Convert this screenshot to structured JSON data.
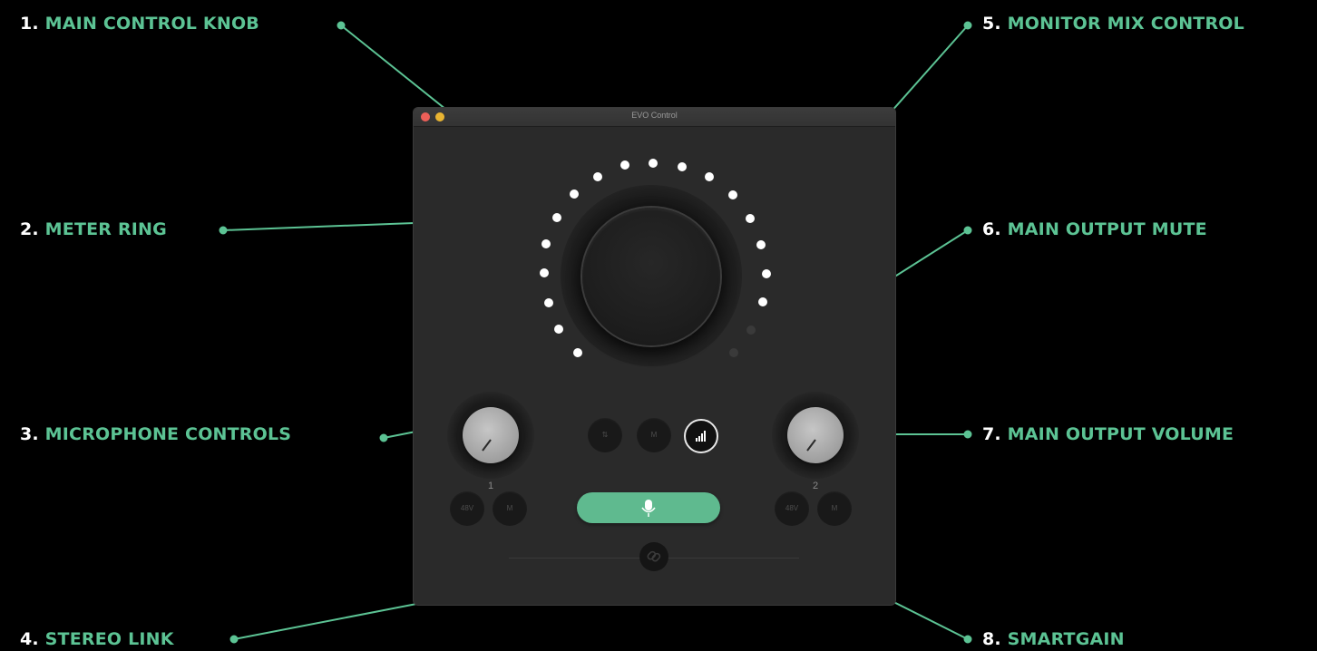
{
  "callouts": [
    {
      "num": "1.",
      "text": "MAIN CONTROL KNOB"
    },
    {
      "num": "2.",
      "text": "METER RING"
    },
    {
      "num": "3.",
      "text": "MICROPHONE CONTROLS"
    },
    {
      "num": "4.",
      "text": "STEREO LINK"
    },
    {
      "num": "5.",
      "text": "MONITOR MIX CONTROL"
    },
    {
      "num": "6.",
      "text": "MAIN OUTPUT MUTE"
    },
    {
      "num": "7.",
      "text": "MAIN OUTPUT VOLUME"
    },
    {
      "num": "8.",
      "text": "SMARTGAIN"
    }
  ],
  "window": {
    "title": "EVO Control"
  },
  "channels": [
    {
      "number": "1",
      "phantom_label": "48V",
      "mute_label": "M"
    },
    {
      "number": "2",
      "phantom_label": "48V",
      "mute_label": "M"
    }
  ],
  "output_buttons": {
    "monitor_label": "⇅",
    "mute_label": "M"
  },
  "icons": {
    "smartgain": "microphone-icon",
    "volume": "signal-bars-icon",
    "link": "chain-link-icon"
  },
  "colors": {
    "accent": "#5cc394",
    "smartgain_button": "#5fba8f",
    "background": "#000000",
    "window": "#2a2a2a"
  }
}
